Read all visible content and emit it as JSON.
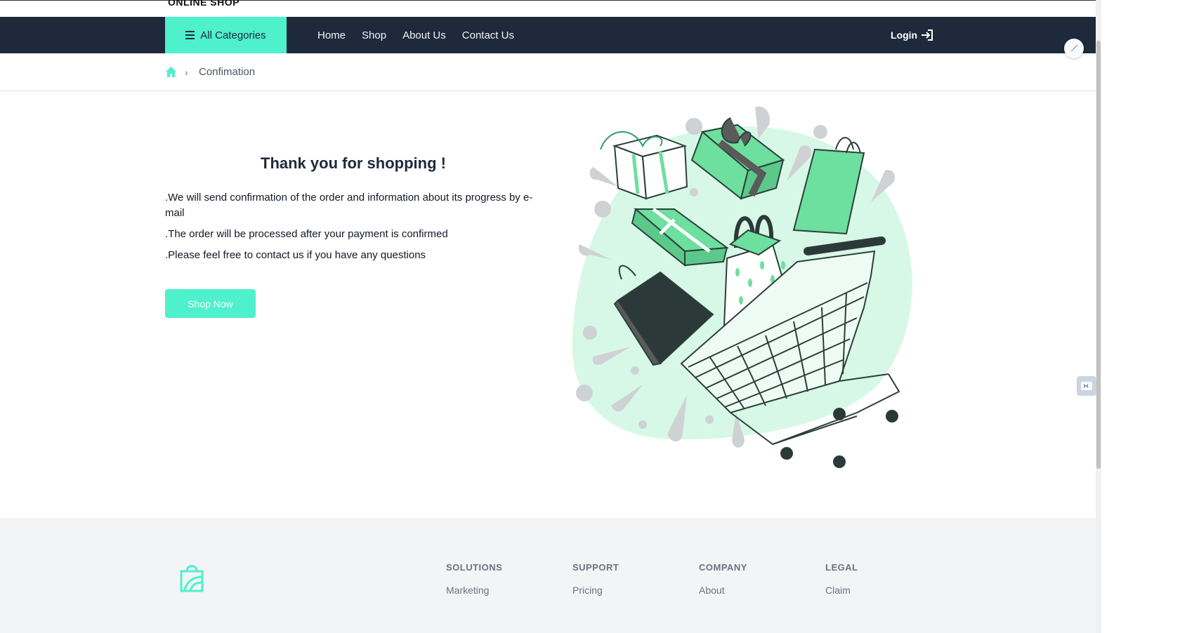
{
  "brand": {
    "name": "ONLINE SHOP"
  },
  "nav": {
    "all_categories": "All Categories",
    "links": [
      "Home",
      "Shop",
      "About Us",
      "Contact Us"
    ],
    "login": "Login"
  },
  "breadcrumb": {
    "current": "Confimation"
  },
  "main": {
    "title": "Thank you for shopping !",
    "messages": [
      ".We will send confirmation of the order and information about its progress by e-mail",
      ".The order will be processed after your payment is confirmed",
      ".Please feel free to contact us if you have any questions"
    ],
    "shop_now": "Shop Now"
  },
  "footer": {
    "columns": [
      {
        "heading": "SOLUTIONS",
        "first_item": "Marketing"
      },
      {
        "heading": "SUPPORT",
        "first_item": "Pricing"
      },
      {
        "heading": "COMPANY",
        "first_item": "About"
      },
      {
        "heading": "LEGAL",
        "first_item": "Claim"
      }
    ]
  },
  "colors": {
    "accent": "#4ff0cc",
    "nav_bg": "#1e293b",
    "footer_bg": "#f3f4f6"
  }
}
